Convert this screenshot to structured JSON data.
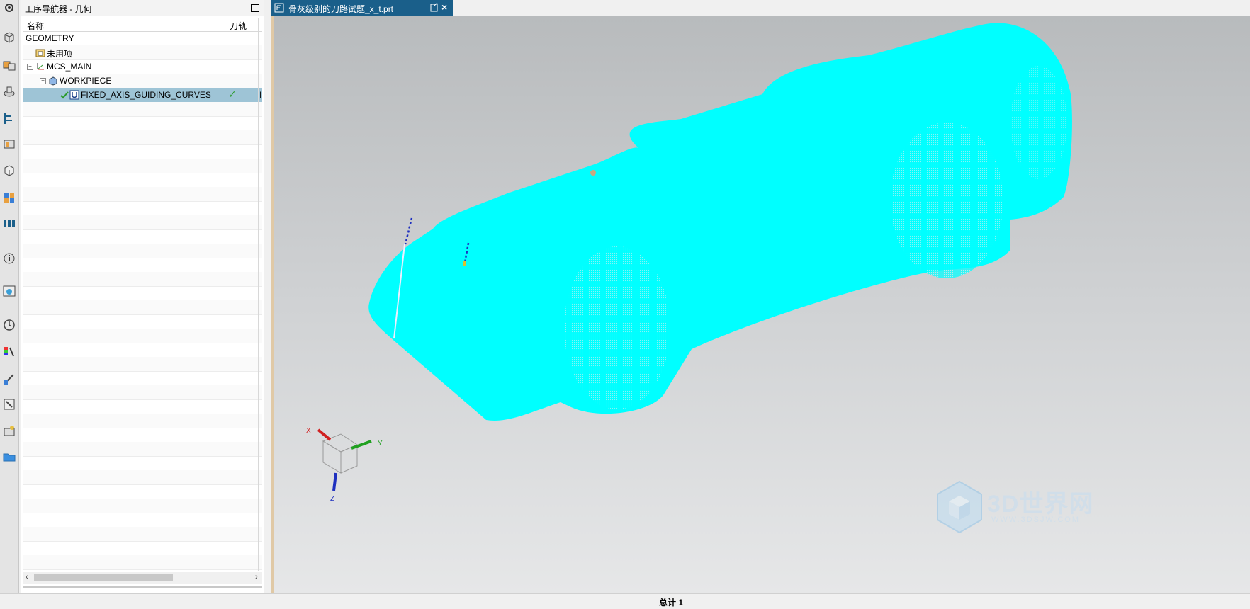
{
  "navigator": {
    "title": "工序导航器 - 几何",
    "columns": {
      "name": "名称",
      "toolpath": "刀轨"
    },
    "rows": [
      {
        "label": "GEOMETRY",
        "indent": 0
      },
      {
        "label": "未用项",
        "indent": 1
      },
      {
        "label": "MCS_MAIN",
        "indent": 1
      },
      {
        "label": "WORKPIECE",
        "indent": 2
      },
      {
        "label": "FIXED_AXIS_GUIDING_CURVES",
        "indent": 3,
        "selected": true,
        "status": "✓",
        "extra": "I"
      }
    ]
  },
  "tab": {
    "label": "骨灰级别的刀路试题_x_t.prt",
    "close": "×"
  },
  "triad": {
    "x": "X",
    "y": "Y",
    "z": "Z"
  },
  "watermark": {
    "brand": "3D世界网",
    "url": "WWW.3DSJW.COM"
  },
  "status": {
    "text": "总计 1"
  },
  "colors": {
    "model": "#00ffff",
    "tab": "#1a5f8a",
    "selection": "#9ec4d6"
  },
  "toolbar": {
    "icons": [
      "settings-icon",
      "part-navigator-icon",
      "assembly-navigator-icon",
      "constraint-navigator-icon",
      "operation-navigator-icon",
      "machine-tool-icon",
      "part-icon",
      "reuse-library-icon",
      "process-icon",
      "info-icon",
      "web-browser-icon",
      "history-icon",
      "color-palette-icon",
      "measure-icon",
      "tools-icon",
      "manufacturing-icon",
      "folder-icon"
    ]
  }
}
